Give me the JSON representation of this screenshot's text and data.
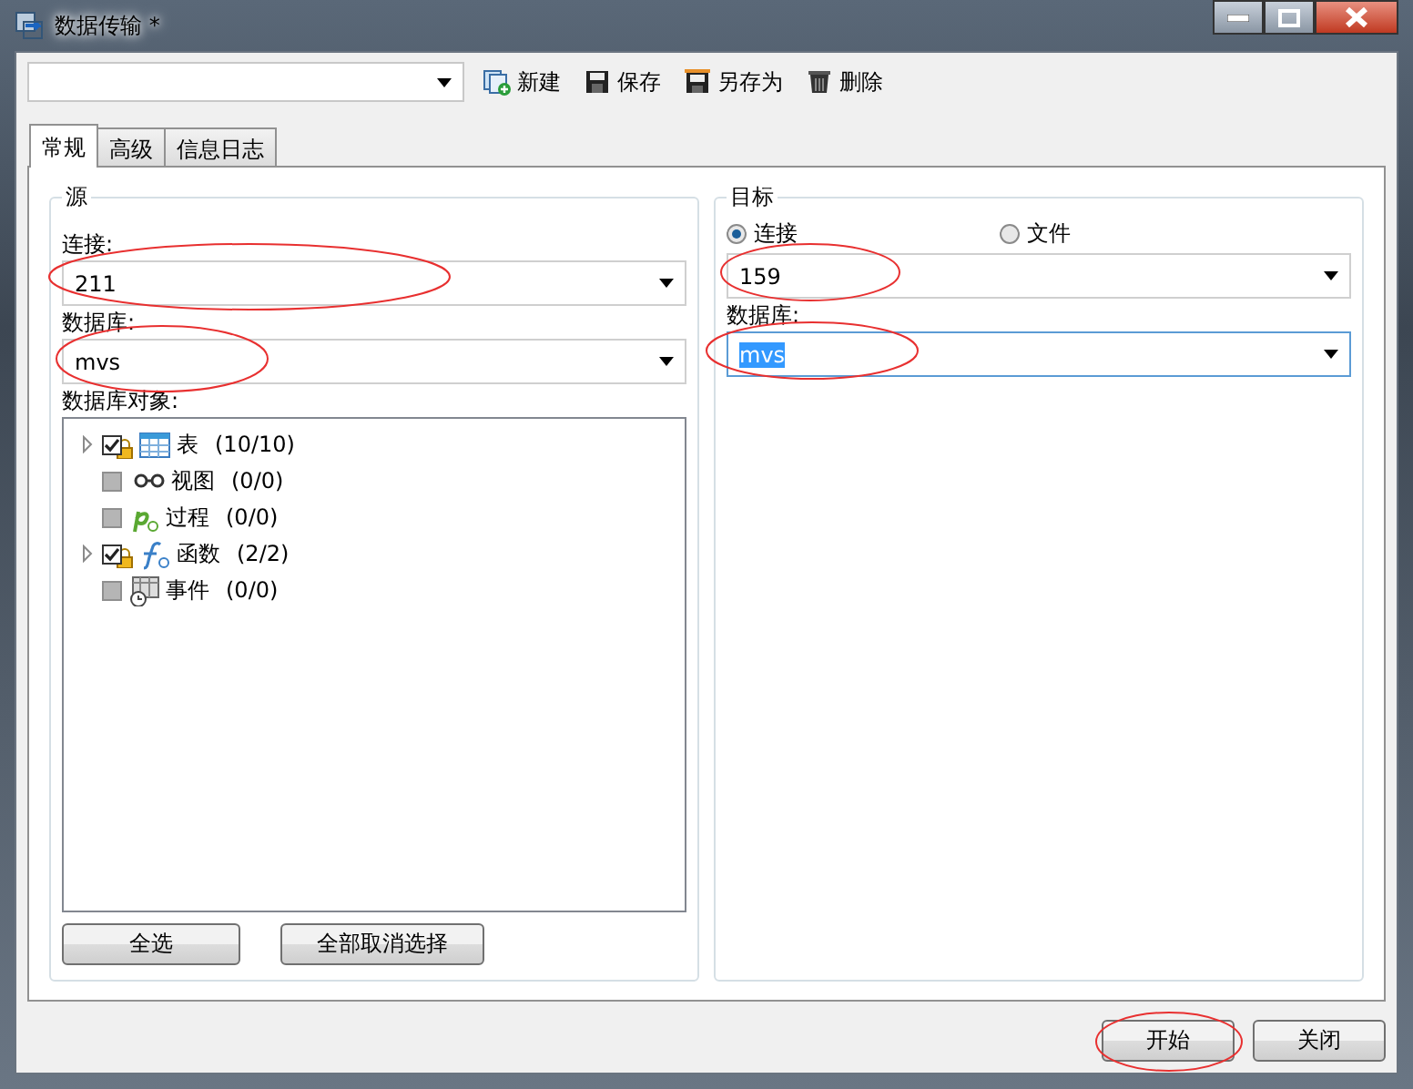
{
  "window": {
    "title": "数据传输 *"
  },
  "toolbar": {
    "buttons": [
      {
        "kind": "new",
        "label": "新建"
      },
      {
        "kind": "save",
        "label": "保存"
      },
      {
        "kind": "saveas",
        "label": "另存为"
      },
      {
        "kind": "delete",
        "label": "删除"
      }
    ]
  },
  "tabs": [
    {
      "label": "常规",
      "selected": true
    },
    {
      "label": "高级",
      "selected": false
    },
    {
      "label": "信息日志",
      "selected": false
    }
  ],
  "source": {
    "title": "源",
    "connection": {
      "label": "连接:",
      "value": "211",
      "highlighted": true
    },
    "database": {
      "label": "数据库:",
      "value": "mvs",
      "highlighted": true
    },
    "objects_label": "数据库对象:",
    "objects": [
      {
        "kind": "table",
        "name": "表",
        "count": "(10/10)",
        "checked": true,
        "expandable": true
      },
      {
        "kind": "view",
        "name": "视图",
        "count": "(0/0)",
        "checked": false,
        "expandable": false
      },
      {
        "kind": "procedure",
        "name": "过程",
        "count": "(0/0)",
        "checked": false,
        "expandable": false
      },
      {
        "kind": "function",
        "name": "函数",
        "count": "(2/2)",
        "checked": true,
        "expandable": true
      },
      {
        "kind": "event",
        "name": "事件",
        "count": "(0/0)",
        "checked": false,
        "expandable": false
      }
    ],
    "buttons": [
      "全选",
      "全部取消选择"
    ]
  },
  "target": {
    "title": "目标",
    "modes": [
      {
        "label": "连接",
        "selected": true
      },
      {
        "label": "文件",
        "selected": false
      }
    ],
    "connection": {
      "value": "159",
      "highlighted": true
    },
    "database": {
      "label": "数据库:",
      "value": "mvs",
      "highlighted": true,
      "text_selected": true
    }
  },
  "footer": {
    "buttons": [
      {
        "label": "开始",
        "highlighted": true
      },
      {
        "label": "关闭",
        "highlighted": false
      }
    ]
  }
}
